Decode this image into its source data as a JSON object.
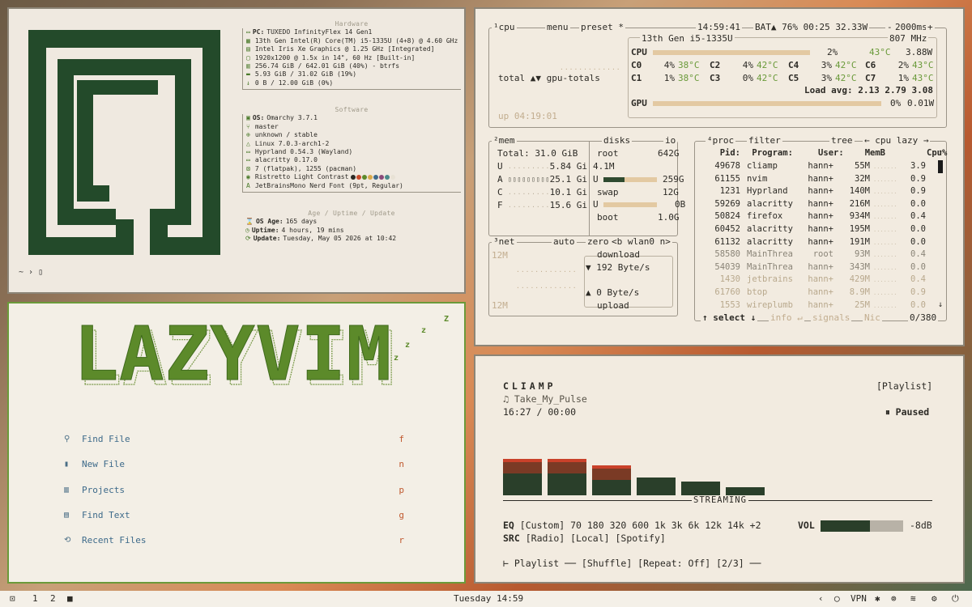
{
  "fetch": {
    "hardware_title": "Hardware",
    "hardware": [
      {
        "icon": "▭",
        "label": "PC:",
        "value": "TUXEDO InfinityFlex 14 Gen1"
      },
      {
        "icon": "▦",
        "label": "",
        "value": "13th Gen Intel(R) Core(TM) i5-1335U (4+8) @ 4.60 GHz"
      },
      {
        "icon": "▤",
        "label": "",
        "value": "Intel Iris Xe Graphics @ 1.25 GHz [Integrated]"
      },
      {
        "icon": "▢",
        "label": "",
        "value": "1920x1200 @ 1.5x in 14\", 60 Hz [Built-in]"
      },
      {
        "icon": "▥",
        "label": "",
        "value": "256.74 GiB / 642.01 GiB (40%) - btrfs"
      },
      {
        "icon": "▬",
        "label": "",
        "value": "5.93 GiB / 31.02 GiB (19%)"
      },
      {
        "icon": "↓",
        "label": "",
        "value": "0 B / 12.00 GiB (0%)"
      }
    ],
    "software_title": "Software",
    "software": [
      {
        "icon": "▣",
        "label": "OS:",
        "value": "Omarchy 3.7.1"
      },
      {
        "icon": "⑂",
        "label": "",
        "value": "master"
      },
      {
        "icon": "⊕",
        "label": "",
        "value": "unknown / stable"
      },
      {
        "icon": "△",
        "label": "",
        "value": "Linux 7.0.3-arch1-2"
      },
      {
        "icon": "▭",
        "label": "",
        "value": "Hyprland 0.54.3 (Wayland)"
      },
      {
        "icon": "▭",
        "label": "",
        "value": "alacritty 0.17.0"
      },
      {
        "icon": "⊠",
        "label": "",
        "value": "7 (flatpak), 1255 (pacman)"
      },
      {
        "icon": "◉",
        "label": "",
        "value": "Ristretto Light Contrast"
      },
      {
        "icon": "A",
        "label": "",
        "value": "JetBrainsMono Nerd Font (9pt, Regular)"
      }
    ],
    "theme_dots": [
      "#2c2a25",
      "#c94a2a",
      "#5c8a2a",
      "#d9a94a",
      "#3d6a8a",
      "#8a4a7a",
      "#4a8a8a",
      "#e8e2d5"
    ],
    "age_title": "Age / Uptime / Update",
    "age": [
      {
        "icon": "⌛",
        "label": "OS Age:",
        "value": "165 days"
      },
      {
        "icon": "◷",
        "label": "Uptime:",
        "value": "4 hours, 19 mins"
      },
      {
        "icon": "⟳",
        "label": "Update:",
        "value": "Tuesday, May 05 2026 at 10:42"
      }
    ],
    "prompt": "~ › ▯"
  },
  "nvim": {
    "logo_text": "LAZYVIM",
    "menu": [
      {
        "icon": "search-icon",
        "glyph": "⚲",
        "label": "Find File",
        "key": "f"
      },
      {
        "icon": "file-icon",
        "glyph": "▮",
        "label": "New File",
        "key": "n"
      },
      {
        "icon": "projects-icon",
        "glyph": "▥",
        "label": "Projects",
        "key": "p"
      },
      {
        "icon": "text-icon",
        "glyph": "▤",
        "label": "Find Text",
        "key": "g"
      },
      {
        "icon": "recent-icon",
        "glyph": "⟲",
        "label": "Recent Files",
        "key": "r"
      }
    ]
  },
  "btop": {
    "cpu": {
      "tab_num": "¹",
      "tab": "cpu",
      "menu": "menu",
      "preset": "preset *",
      "clock": "14:59:41",
      "battery": "BAT▲ 76% 00:25 32.33W",
      "interval": "2000ms",
      "plus": "+",
      "minus": "-",
      "model": "13th Gen i5-1335U",
      "freq": "807 MHz",
      "cpu_label": "CPU",
      "cpu_pct": "2%",
      "cpu_temp": "43°C",
      "cpu_watt": "3.88W",
      "cores": [
        {
          "name": "C0",
          "pct": "4%",
          "temp": "38°C"
        },
        {
          "name": "C1",
          "pct": "1%",
          "temp": "38°C"
        },
        {
          "name": "C2",
          "pct": "4%",
          "temp": "42°C"
        },
        {
          "name": "C3",
          "pct": "0%",
          "temp": "42°C"
        },
        {
          "name": "C4",
          "pct": "3%",
          "temp": "42°C"
        },
        {
          "name": "C5",
          "pct": "3%",
          "temp": "42°C"
        },
        {
          "name": "C6",
          "pct": "2%",
          "temp": "43°C"
        },
        {
          "name": "C7",
          "pct": "1%",
          "temp": "43°C"
        }
      ],
      "load": "Load avg: 2.13 2.79 3.08",
      "gpu_label": "GPU",
      "gpu_pct": "0%",
      "gpu_watt": "0.01W",
      "total_label": "total ▲▼ gpu-totals",
      "uptime": "up 04:19:01"
    },
    "mem": {
      "tab_num": "²",
      "tab": "mem",
      "disks": "disks",
      "io": "io",
      "total": "Total: 31.0 GiB",
      "rows": [
        {
          "k": "U",
          "v": "5.84 Gi"
        },
        {
          "k": "A",
          "v": "25.1 Gi"
        },
        {
          "k": "C",
          "v": "10.1 Gi"
        },
        {
          "k": "F",
          "v": "15.6 Gi"
        }
      ],
      "root_label": "root",
      "root_size": "642G",
      "root_io": "4.1M",
      "root_used_label": "U",
      "root_used": "259G",
      "root_used_frac": 0.4,
      "swap_label": "swap",
      "swap_size": "12G",
      "swap_used_label": "U",
      "swap_used": "0B",
      "swap_used_frac": 0.0,
      "boot_label": "boot",
      "boot_size": "1.0G"
    },
    "net": {
      "tab_num": "³",
      "tab": "net",
      "auto": "auto",
      "zero": "zero",
      "iface": "<b wlan0 n>",
      "scale_top": "12M",
      "scale_bottom": "12M",
      "download": "download",
      "down_rate": "▼ 192 Byte/s",
      "up_rate": "▲ 0 Byte/s",
      "upload": "upload"
    },
    "proc": {
      "tab_num": "⁴",
      "tab": "proc",
      "filter": "filter",
      "tree": "tree",
      "sort": "← cpu lazy →",
      "headers": {
        "pid": "Pid:",
        "program": "Program:",
        "user": "User:",
        "mem": "MemB",
        "cpu": "Cpu%"
      },
      "rows": [
        {
          "pid": "49678",
          "program": "cliamp",
          "user": "hann+",
          "mem": "55M",
          "cpu": "3.9"
        },
        {
          "pid": "61155",
          "program": "nvim",
          "user": "hann+",
          "mem": "32M",
          "cpu": "0.9"
        },
        {
          "pid": "1231",
          "program": "Hyprland",
          "user": "hann+",
          "mem": "140M",
          "cpu": "0.9"
        },
        {
          "pid": "59269",
          "program": "alacritty",
          "user": "hann+",
          "mem": "216M",
          "cpu": "0.0"
        },
        {
          "pid": "50824",
          "program": "firefox",
          "user": "hann+",
          "mem": "934M",
          "cpu": "0.4"
        },
        {
          "pid": "60452",
          "program": "alacritty",
          "user": "hann+",
          "mem": "195M",
          "cpu": "0.0"
        },
        {
          "pid": "61132",
          "program": "alacritty",
          "user": "hann+",
          "mem": "191M",
          "cpu": "0.0"
        },
        {
          "pid": "58580",
          "program": "MainThrea",
          "user": "root",
          "mem": "93M",
          "cpu": "0.4"
        },
        {
          "pid": "54039",
          "program": "MainThrea",
          "user": "hann+",
          "mem": "343M",
          "cpu": "0.0"
        },
        {
          "pid": "1430",
          "program": "jetbrains",
          "user": "hann+",
          "mem": "429M",
          "cpu": "0.4"
        },
        {
          "pid": "61760",
          "program": "btop",
          "user": "hann+",
          "mem": "8.9M",
          "cpu": "0.9"
        },
        {
          "pid": "1553",
          "program": "wireplumb",
          "user": "hann+",
          "mem": "25M",
          "cpu": "0.0"
        }
      ],
      "footer_select": "↑ select ↓",
      "footer_info": "info ↵",
      "footer_signals": "signals",
      "footer_nice": "Nic",
      "footer_count": "0/380"
    }
  },
  "cliamp": {
    "title": "CLIAMP",
    "playlist_label": "[Playlist]",
    "track": "♫ Take_My_Pulse",
    "time": "16:27 / 00:00",
    "status": "⏸ Paused",
    "spectrum": [
      0.9,
      0.9,
      0.75,
      0.45,
      0.35,
      0.2
    ],
    "streaming": "STREAMING",
    "eq_label": "EQ",
    "eq_value": "[Custom] 70 180 320 600 1k 3k 6k 12k 14k +2",
    "src_label": "SRC",
    "src_value": "[Radio] [Local] [Spotify]",
    "vol_label": "VOL",
    "vol_frac": 0.6,
    "vol_value": "-8dB",
    "footer": "⊢ Playlist ── [Shuffle] [Repeat: Off] [2/3] ──"
  },
  "taskbar": {
    "ws_icon": "⊡",
    "workspaces": [
      "1",
      "2"
    ],
    "active_ws": "■",
    "clock": "Tuesday 14:59",
    "vpn": "VPN",
    "tray": [
      "‹",
      "◯",
      "VPN",
      "✱",
      "⊚",
      "≋",
      "⚙",
      "⏻"
    ]
  }
}
